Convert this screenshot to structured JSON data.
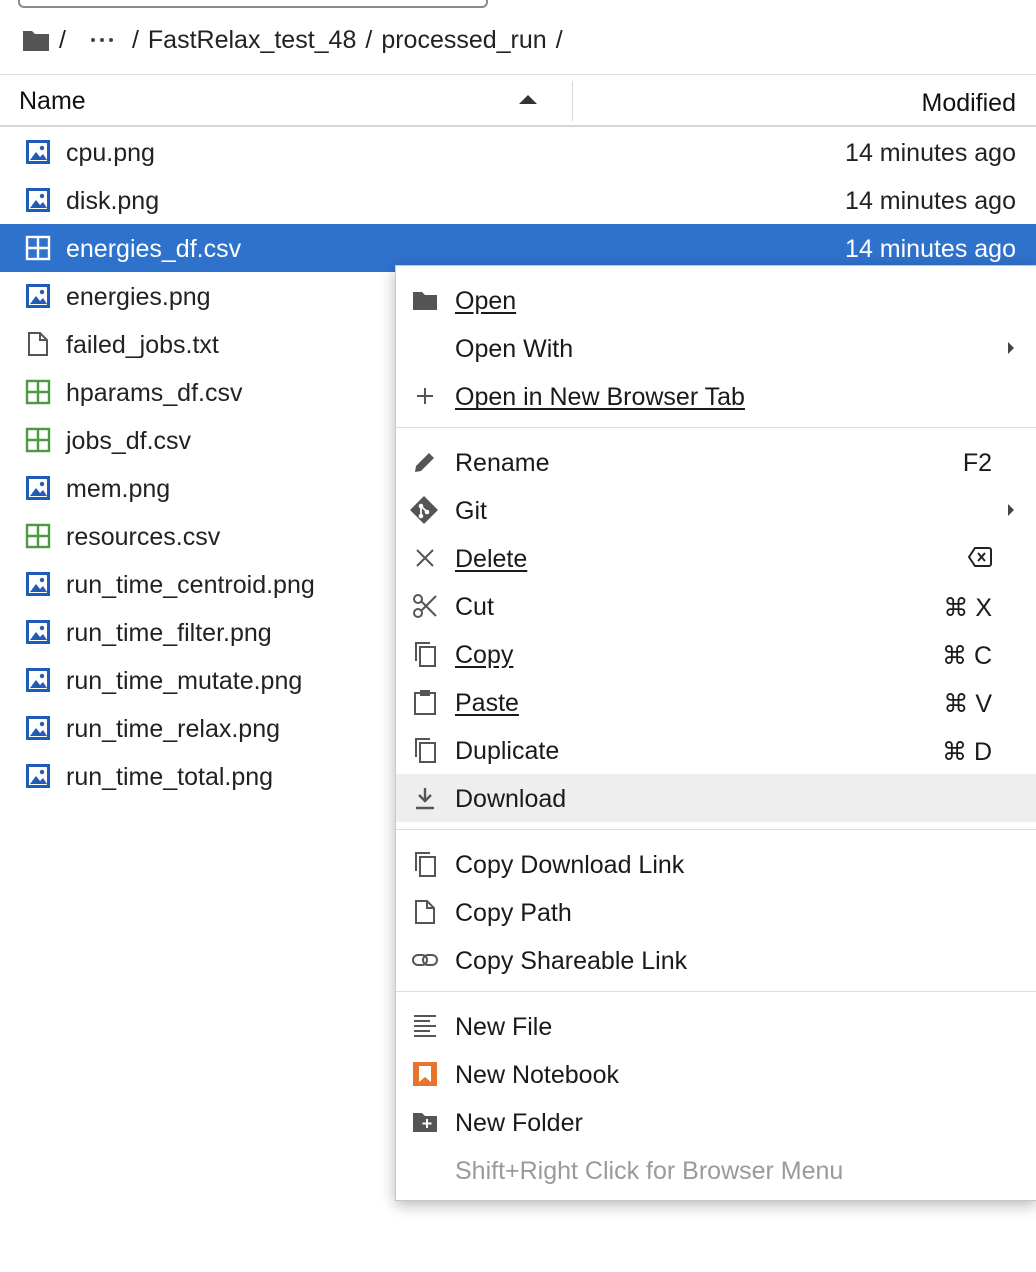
{
  "breadcrumb": {
    "separator": "/",
    "segments": [
      "FastRelax_test_48",
      "processed_run"
    ]
  },
  "header": {
    "name": "Name",
    "modified": "Modified"
  },
  "files": [
    {
      "name": "cpu.png",
      "modified": "14 minutes ago",
      "icon": "image-icon"
    },
    {
      "name": "disk.png",
      "modified": "14 minutes ago",
      "icon": "image-icon"
    },
    {
      "name": "energies_df.csv",
      "modified": "14 minutes ago",
      "icon": "spreadsheet-icon",
      "selected": true
    },
    {
      "name": "energies.png",
      "modified": "",
      "icon": "image-icon"
    },
    {
      "name": "failed_jobs.txt",
      "modified": "",
      "icon": "file-icon"
    },
    {
      "name": "hparams_df.csv",
      "modified": "",
      "icon": "spreadsheet-icon"
    },
    {
      "name": "jobs_df.csv",
      "modified": "",
      "icon": "spreadsheet-icon"
    },
    {
      "name": "mem.png",
      "modified": "",
      "icon": "image-icon"
    },
    {
      "name": "resources.csv",
      "modified": "",
      "icon": "spreadsheet-icon"
    },
    {
      "name": "run_time_centroid.png",
      "modified": "",
      "icon": "image-icon"
    },
    {
      "name": "run_time_filter.png",
      "modified": "",
      "icon": "image-icon"
    },
    {
      "name": "run_time_mutate.png",
      "modified": "",
      "icon": "image-icon"
    },
    {
      "name": "run_time_relax.png",
      "modified": "",
      "icon": "image-icon"
    },
    {
      "name": "run_time_total.png",
      "modified": "",
      "icon": "image-icon"
    }
  ],
  "menu": {
    "open": "Open",
    "open_with": "Open With",
    "open_new_tab": "Open in New Browser Tab",
    "rename": "Rename",
    "rename_shortcut": "F2",
    "git": "Git",
    "delete": "Delete",
    "cut": "Cut",
    "cut_shortcut": "⌘ X",
    "copy": "Copy",
    "copy_shortcut": "⌘ C",
    "paste": "Paste",
    "paste_shortcut": "⌘ V",
    "duplicate": "Duplicate",
    "duplicate_shortcut": "⌘ D",
    "download": "Download",
    "copy_download_link": "Copy Download Link",
    "copy_path": "Copy Path",
    "copy_shareable_link": "Copy Shareable Link",
    "new_file": "New File",
    "new_notebook": "New Notebook",
    "new_folder": "New Folder",
    "footer_hint": "Shift+Right Click for Browser Menu"
  },
  "colors": {
    "selection": "#2f72cc",
    "image_icon": "#1f5bb8",
    "csv_icon": "#4b9a42",
    "notebook_icon": "#e8742a"
  }
}
